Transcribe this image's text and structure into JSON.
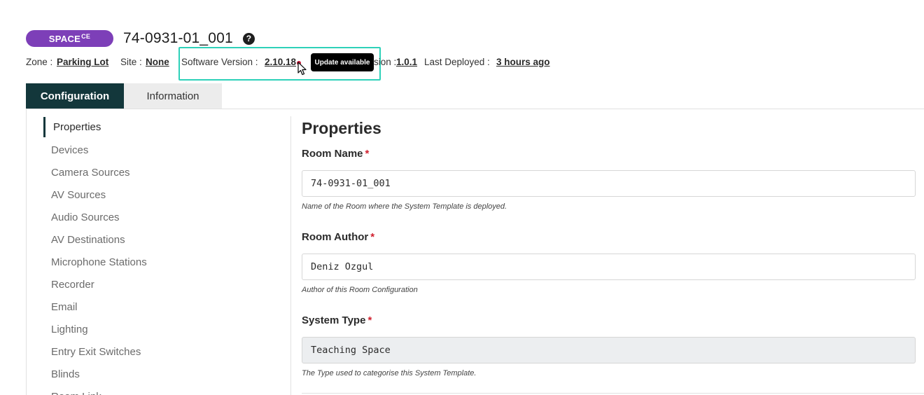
{
  "header": {
    "badge_label": "SPACE",
    "badge_sup": "CE",
    "room_title": "74-0931-01_001",
    "help_icon": "question-circle-icon"
  },
  "meta": {
    "zone_label": "Zone :",
    "zone_value": "Parking Lot",
    "site_label": "Site :",
    "site_value": "None",
    "software_label": "Software Version :",
    "software_value": "2.10.18",
    "template_label": "sion :",
    "template_value": "1.0.1",
    "deployed_label": "Last Deployed :",
    "deployed_value": "3 hours ago",
    "tooltip": "Update available",
    "update_dot_color": "#c61a3a",
    "highlight_color": "#2ed1b9"
  },
  "tabs": [
    {
      "label": "Configuration",
      "active": true
    },
    {
      "label": "Information",
      "active": false
    }
  ],
  "sidenav": {
    "items": [
      "Properties",
      "Devices",
      "Camera Sources",
      "AV Sources",
      "Audio Sources",
      "AV Destinations",
      "Microphone Stations",
      "Recorder",
      "Email",
      "Lighting",
      "Entry Exit Switches",
      "Blinds",
      "Room Link"
    ],
    "active_index": 0
  },
  "content": {
    "title": "Properties",
    "fields": [
      {
        "label": "Room Name",
        "required": "*",
        "value": "74-0931-01_001",
        "hint": "Name of the Room where the System Template is deployed."
      },
      {
        "label": "Room Author",
        "required": "*",
        "value": "Deniz Ozgul",
        "hint": "Author of this Room Configuration"
      },
      {
        "label": "System Type",
        "required": "*",
        "value": "Teaching Space",
        "hint": "The Type used to categorise this System Template."
      }
    ]
  },
  "colors": {
    "accent_dark": "#13373b",
    "badge_purple": "#7d3fb8",
    "required_red": "#d0202e"
  }
}
